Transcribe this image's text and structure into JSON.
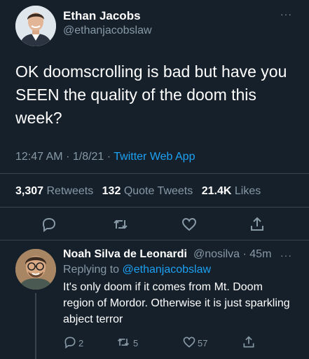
{
  "main_tweet": {
    "author_name": "Ethan Jacobs",
    "author_handle": "@ethanjacobslaw",
    "more": "···",
    "text": "OK doomscrolling is bad but have you SEEN the quality of the doom this week?",
    "time": "12:47 AM",
    "date": "1/8/21",
    "source": "Twitter Web App",
    "stats": {
      "retweets_count": "3,307",
      "retweets_label": "Retweets",
      "quote_count": "132",
      "quote_label": "Quote Tweets",
      "likes_count": "21.4K",
      "likes_label": "Likes"
    }
  },
  "reply": {
    "author_name": "Noah Silva de Leonardi",
    "author_handle": "@nosilva",
    "age": "45m",
    "more": "···",
    "replying_prefix": "Replying to",
    "replying_to": "@ethanjacobslaw",
    "text": "It's only doom if it comes from Mt. Doom region of Mordor. Otherwise it is just sparkling abject terror",
    "reply_count": "2",
    "retweet_count": "5",
    "like_count": "57"
  },
  "colors": {
    "background": "#15202b",
    "accent": "#1da1f2",
    "muted": "#8899a6",
    "divider": "#38444d"
  },
  "icons": [
    "reply-icon",
    "retweet-icon",
    "like-icon",
    "share-icon",
    "more-icon"
  ]
}
